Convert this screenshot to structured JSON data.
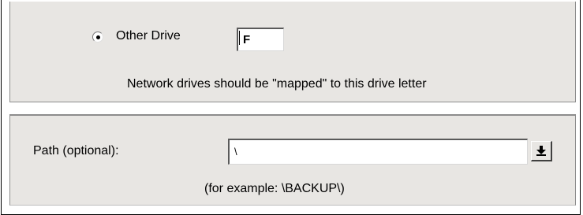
{
  "drive_panel": {
    "radio_label": "Other Drive",
    "radio_selected": true,
    "drive_letter": "F",
    "note": "Network drives should be \"mapped\" to this drive letter"
  },
  "path_panel": {
    "label": "Path (optional):",
    "value": "\\",
    "dropdown_icon": "download-arrow-icon",
    "example": "(for example: \\BACKUP\\)"
  }
}
